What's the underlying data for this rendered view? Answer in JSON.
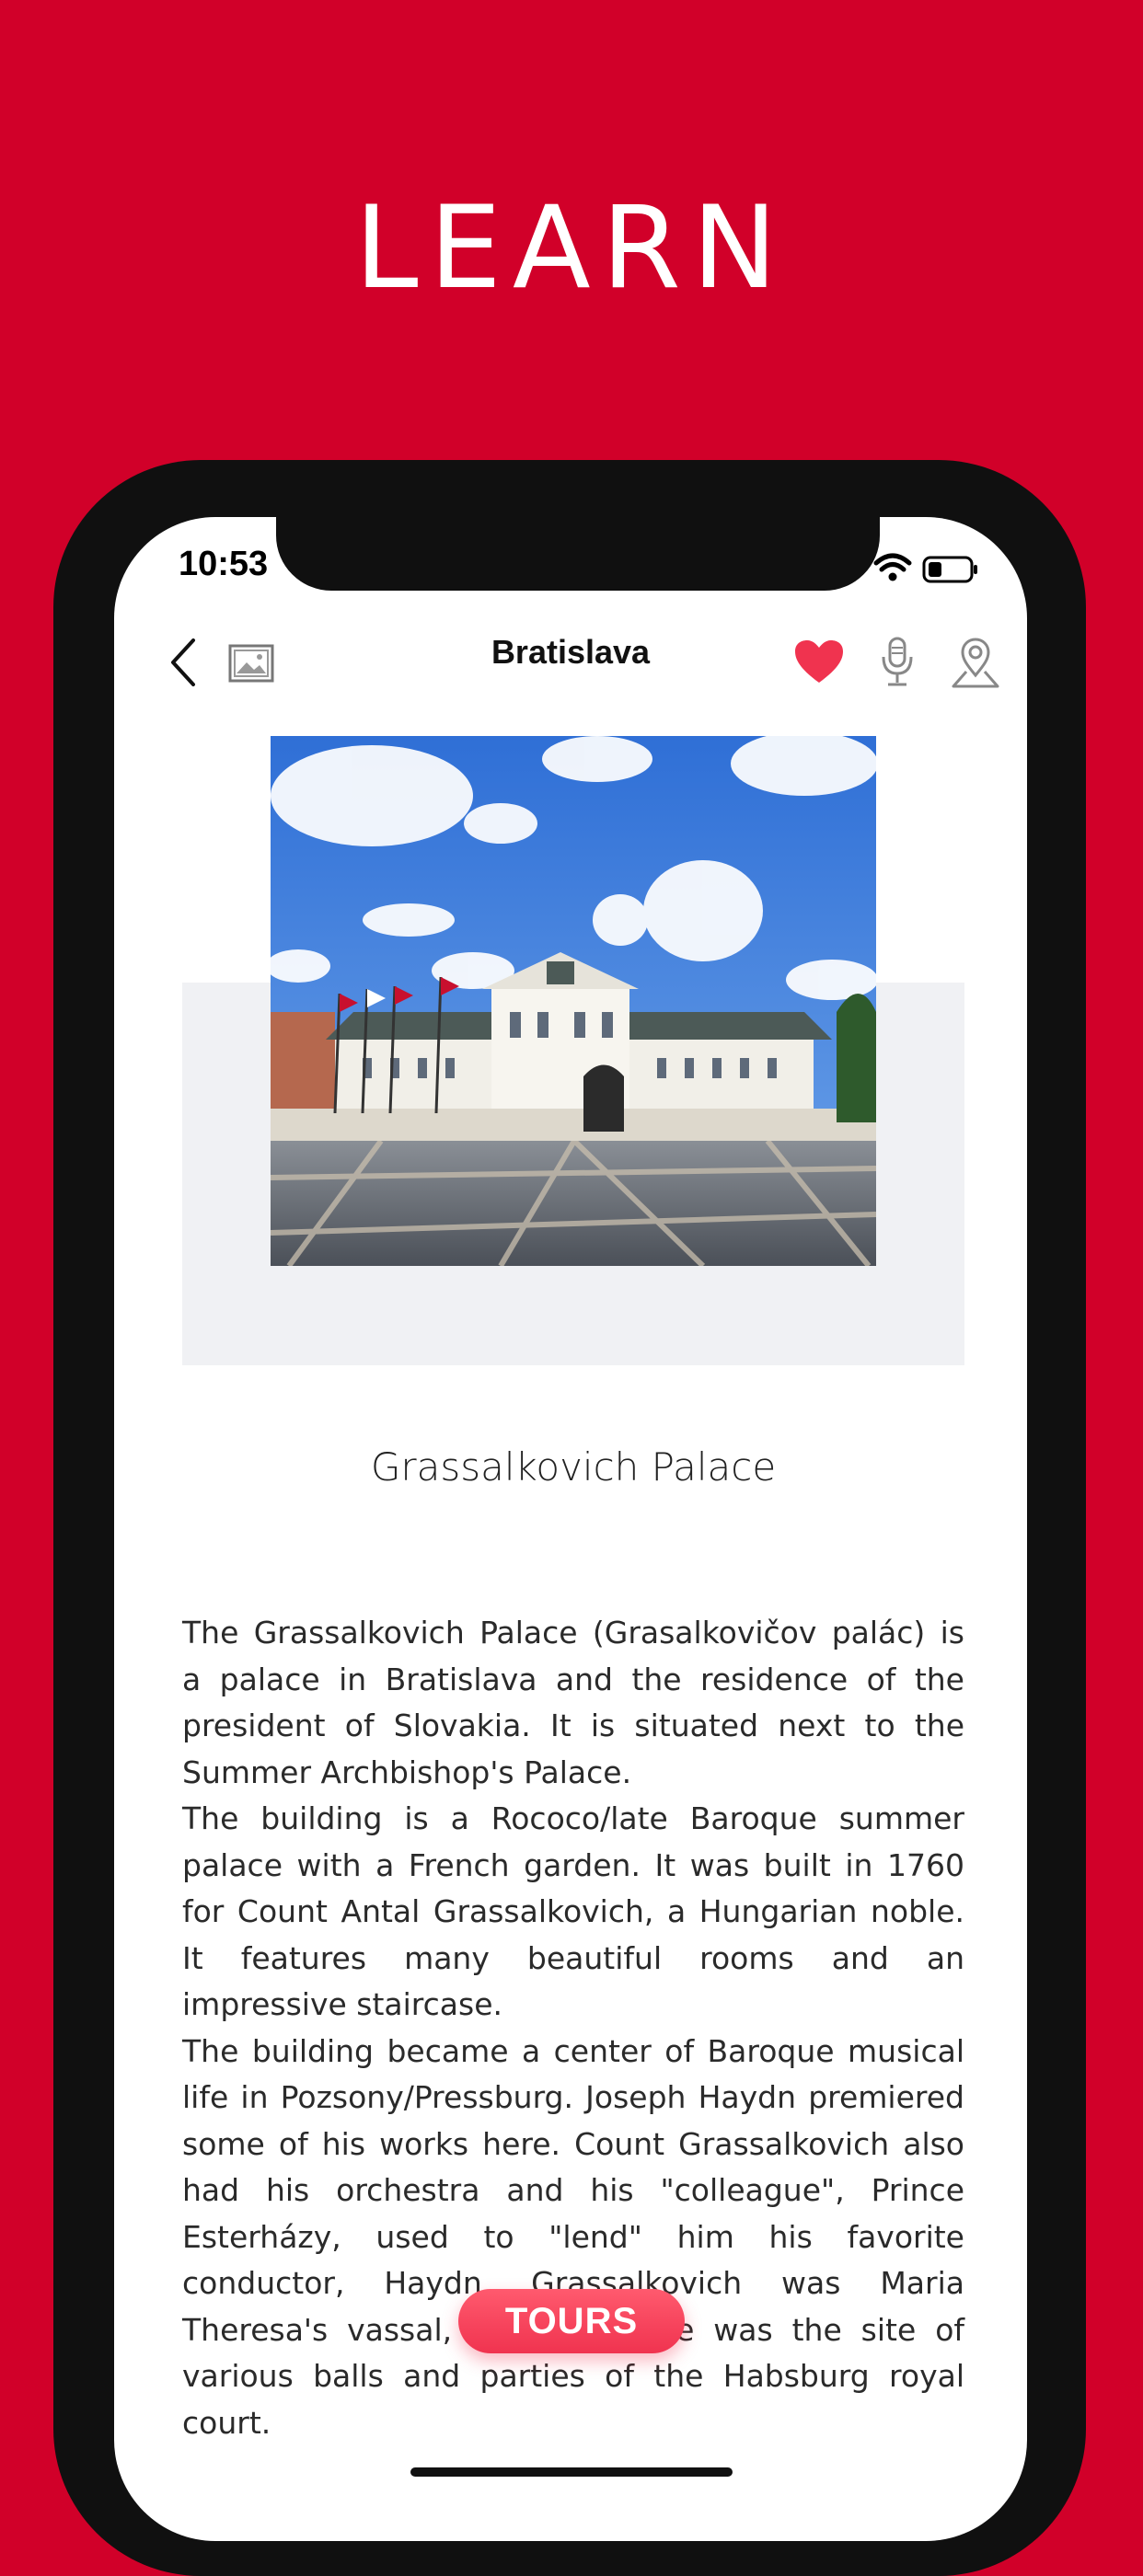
{
  "promo": {
    "headline": "LEARN"
  },
  "status_bar": {
    "time": "10:53"
  },
  "nav": {
    "title": "Bratislava",
    "back_icon": "chevron-left-icon",
    "gallery_icon": "image-icon",
    "favorite_icon": "heart-icon",
    "audio_icon": "microphone-icon",
    "map_icon": "map-pin-icon"
  },
  "place": {
    "title": "Grassalkovich Palace",
    "paragraphs": [
      "The Grassalkovich Palace (Grasalkovičov palác) is a palace in Bratislava and the residence of the president of Slovakia. It is situated next to the Summer Archbishop's Palace.",
      "The building is a Rococo/late Baroque summer palace with a French garden. It was built in 1760 for Count Antal Grassalkovich, a Hungarian noble. It features many beautiful rooms and an impressive staircase.",
      "The building became a center of Baroque musical life in Pozsony/Pressburg. Joseph Haydn premiered some of his works here. Count Grassalkovich also had his orchestra and his \"colleague\", Prince Esterházy, used to \"lend\" him his favorite conductor, Haydn. Grassalkovich was Maria Theresa's vassal, so the palace was the site of various balls and parties of the Habsburg royal court."
    ]
  },
  "tours_button": {
    "label": "TOURS"
  },
  "colors": {
    "brand_red": "#d10029",
    "heart_red": "#f0334f",
    "tours_gradient_top": "#ff5a6e"
  }
}
